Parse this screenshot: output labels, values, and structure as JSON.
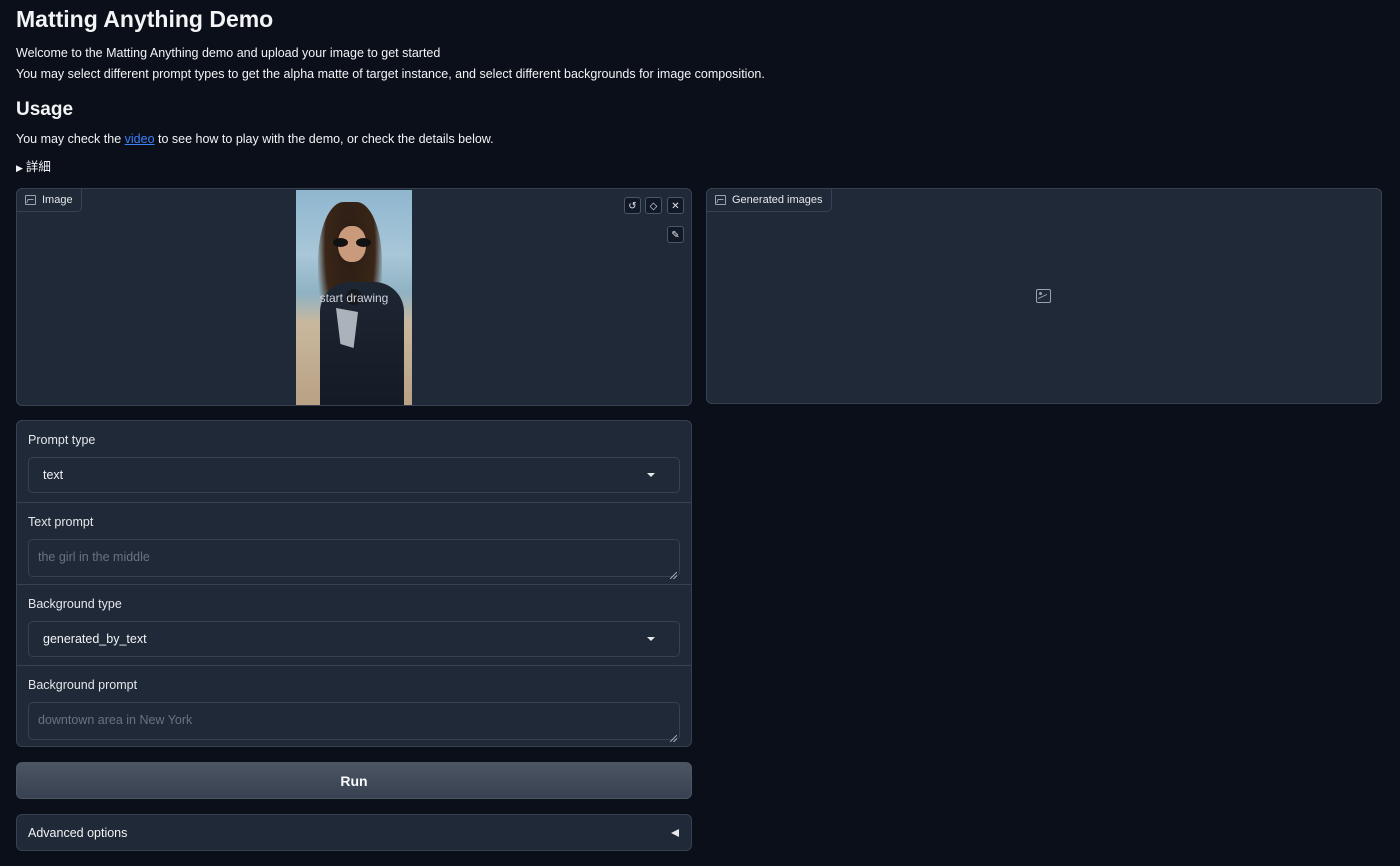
{
  "header": {
    "title": "Matting Anything Demo",
    "intro_line1": "Welcome to the Matting Anything demo and upload your image to get started",
    "intro_line2": "You may select different prompt types to get the alpha matte of target instance, and select different backgrounds for image composition."
  },
  "usage": {
    "title": "Usage",
    "text_before": "You may check the ",
    "link_text": "video",
    "text_after": " to see how to play with the demo, or check the details below.",
    "details_label": "詳細",
    "details_icon": "triangle-right-icon"
  },
  "image_panel": {
    "label": "Image",
    "icon": "image-icon",
    "hint": "start drawing",
    "tools": [
      "undo-icon",
      "eraser-icon",
      "close-icon",
      "brush-icon"
    ]
  },
  "output_panel": {
    "label": "Generated images",
    "icon": "image-icon",
    "empty_icon": "image-placeholder-icon"
  },
  "form": {
    "prompt_type": {
      "label": "Prompt type",
      "value": "text"
    },
    "text_prompt": {
      "label": "Text prompt",
      "placeholder": "the girl in the middle",
      "value": ""
    },
    "background_type": {
      "label": "Background type",
      "value": "generated_by_text"
    },
    "background_prompt": {
      "label": "Background prompt",
      "placeholder": "downtown area in New York",
      "value": ""
    }
  },
  "run_button": {
    "label": "Run"
  },
  "advanced": {
    "label": "Advanced options",
    "icon": "triangle-left-icon"
  },
  "colors": {
    "background": "#0b0f19",
    "panel": "#1f2937",
    "border": "#374151",
    "link": "#3b82f6",
    "button": "#4b5563"
  }
}
